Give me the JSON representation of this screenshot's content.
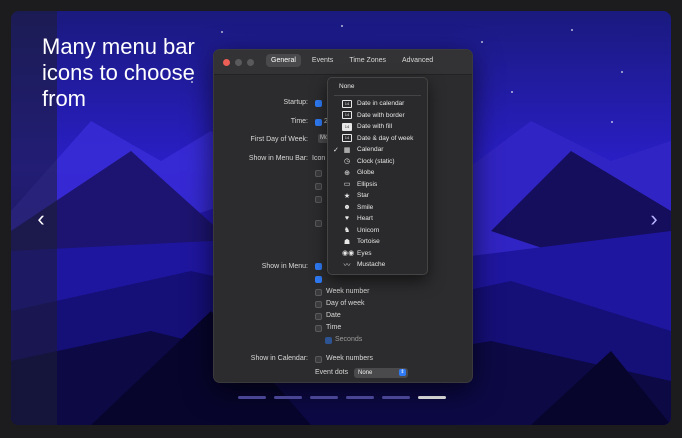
{
  "headline": "Many menu bar icons to choose from",
  "carousel": {
    "prev": "‹",
    "next": "›",
    "dot_count": 6,
    "active_dot": 5
  },
  "prefs": {
    "tabs": [
      "General",
      "Events",
      "Time Zones",
      "Advanced"
    ],
    "selected_tab": 0,
    "labels": {
      "startup": "Startup:",
      "time": "Time:",
      "first_day": "First Day of Week:",
      "show_menu_bar": "Show in Menu Bar:",
      "show_menu": "Show in Menu:",
      "show_calendar": "Show in Calendar:"
    },
    "first_day_value": "Mo",
    "icon_partial": "Icon",
    "time_partial": "2",
    "show_menu_items": [
      {
        "label": "Week number",
        "checked": false
      },
      {
        "label": "Day of week",
        "checked": false
      },
      {
        "label": "Date",
        "checked": false
      },
      {
        "label": "Time",
        "checked": false
      },
      {
        "label": "Seconds",
        "checked": true,
        "disabled": true
      }
    ],
    "calendar_items": [
      {
        "label": "Week numbers",
        "checked": false
      }
    ],
    "event_dots_label": "Event dots",
    "event_dots_value": "None"
  },
  "menu": {
    "none_label": "None",
    "items": [
      {
        "label": "Date in calendar",
        "icon": "calendar-14-icon",
        "glyph": "14",
        "checked": false
      },
      {
        "label": "Date with border",
        "icon": "date-border-icon",
        "glyph": "14",
        "checked": false
      },
      {
        "label": "Date with fill",
        "icon": "date-fill-icon",
        "glyph": "14",
        "checked": false
      },
      {
        "label": "Date & day of week",
        "icon": "date-day-icon",
        "glyph": "14",
        "checked": false
      },
      {
        "label": "Calendar",
        "icon": "calendar-icon",
        "glyph": "▦",
        "checked": true
      },
      {
        "label": "Clock (static)",
        "icon": "clock-icon",
        "glyph": "◷",
        "checked": false
      },
      {
        "label": "Globe",
        "icon": "globe-icon",
        "glyph": "⊕",
        "checked": false
      },
      {
        "label": "Ellipsis",
        "icon": "ellipsis-icon",
        "glyph": "▭",
        "checked": false
      },
      {
        "label": "Star",
        "icon": "star-icon",
        "glyph": "★",
        "checked": false
      },
      {
        "label": "Smile",
        "icon": "smile-icon",
        "glyph": "☻",
        "checked": false
      },
      {
        "label": "Heart",
        "icon": "heart-icon",
        "glyph": "♥",
        "checked": false
      },
      {
        "label": "Unicorn",
        "icon": "unicorn-icon",
        "glyph": "♞",
        "checked": false
      },
      {
        "label": "Tortoise",
        "icon": "tortoise-icon",
        "glyph": "☗",
        "checked": false
      },
      {
        "label": "Eyes",
        "icon": "eyes-icon",
        "glyph": "◉◉",
        "checked": false
      },
      {
        "label": "Mustache",
        "icon": "mustache-icon",
        "glyph": "〰",
        "checked": false
      }
    ]
  },
  "colors": {
    "accent": "#2f7bf6",
    "background": "#2a1ec8"
  }
}
